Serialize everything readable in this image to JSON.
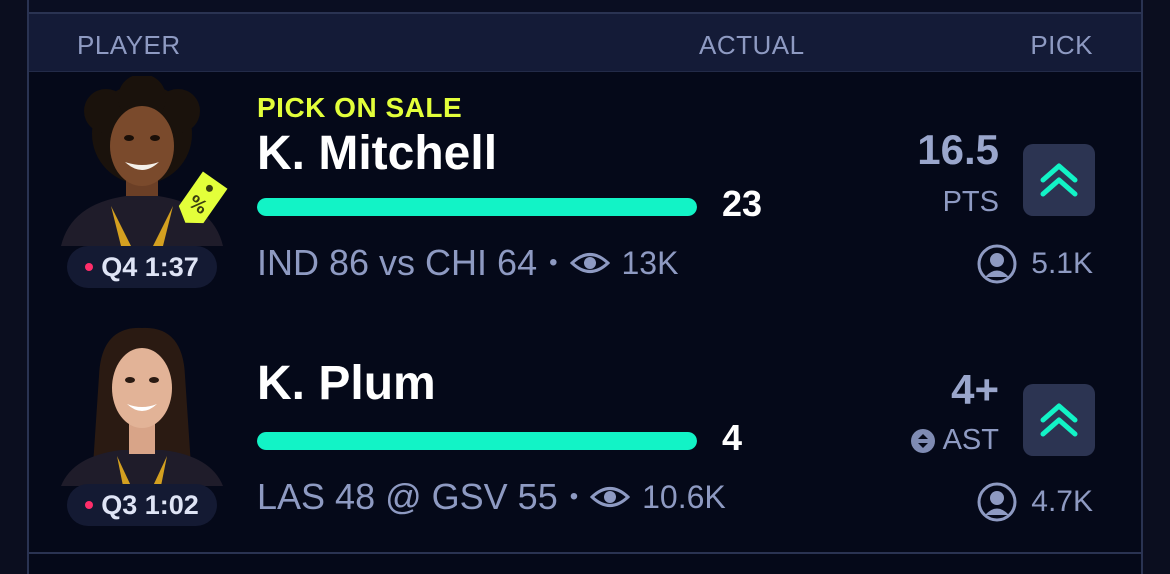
{
  "header": {
    "col_player": "PLAYER",
    "col_actual": "ACTUAL",
    "col_pick": "PICK"
  },
  "rows": [
    {
      "sale_label": "PICK ON SALE",
      "player": "K. Mitchell",
      "clock": "Q4 1:37",
      "actual": "23",
      "progress": 1.0,
      "game": "IND 86 vs CHI 64",
      "viewers": "13K",
      "line": "16.5",
      "stat": "PTS",
      "pickers": "5.1K",
      "icons": [
        "sale-tag-icon",
        "eye-icon",
        "double-chevron-up-icon",
        "user-icon"
      ]
    },
    {
      "player": "K. Plum",
      "clock": "Q3 1:02",
      "actual": "4",
      "progress": 1.0,
      "game": "LAS 48 @ GSV 55",
      "viewers": "10.6K",
      "line": "4+",
      "stat": "AST",
      "pickers": "4.7K",
      "icons": [
        "swap-icon",
        "eye-icon",
        "double-chevron-up-icon",
        "user-icon"
      ]
    }
  ],
  "colors": {
    "accent": "#12f3c6",
    "sale": "#e3ff3a",
    "live_dot": "#ff2d6a",
    "background": "#050919"
  }
}
